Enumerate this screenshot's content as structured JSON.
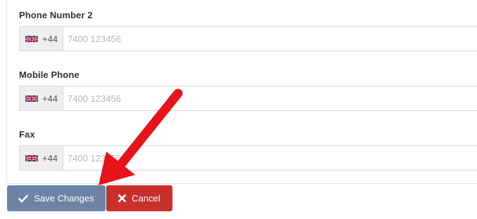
{
  "fields": [
    {
      "label": "Phone Number 2",
      "country_code": "+44",
      "placeholder": "7400 123456",
      "flag": "uk-flag-icon"
    },
    {
      "label": "Mobile Phone",
      "country_code": "+44",
      "placeholder": "7400 123456",
      "flag": "uk-flag-icon"
    },
    {
      "label": "Fax",
      "country_code": "+44",
      "placeholder": "7400 123456",
      "flag": "uk-flag-icon"
    }
  ],
  "actions": {
    "save_label": "Save Changes",
    "save_icon": "check-icon",
    "cancel_label": "Cancel",
    "cancel_icon": "close-icon"
  },
  "colors": {
    "save_bg": "#6c84a5",
    "cancel_bg": "#c9302c",
    "arrow": "#e8141b"
  }
}
